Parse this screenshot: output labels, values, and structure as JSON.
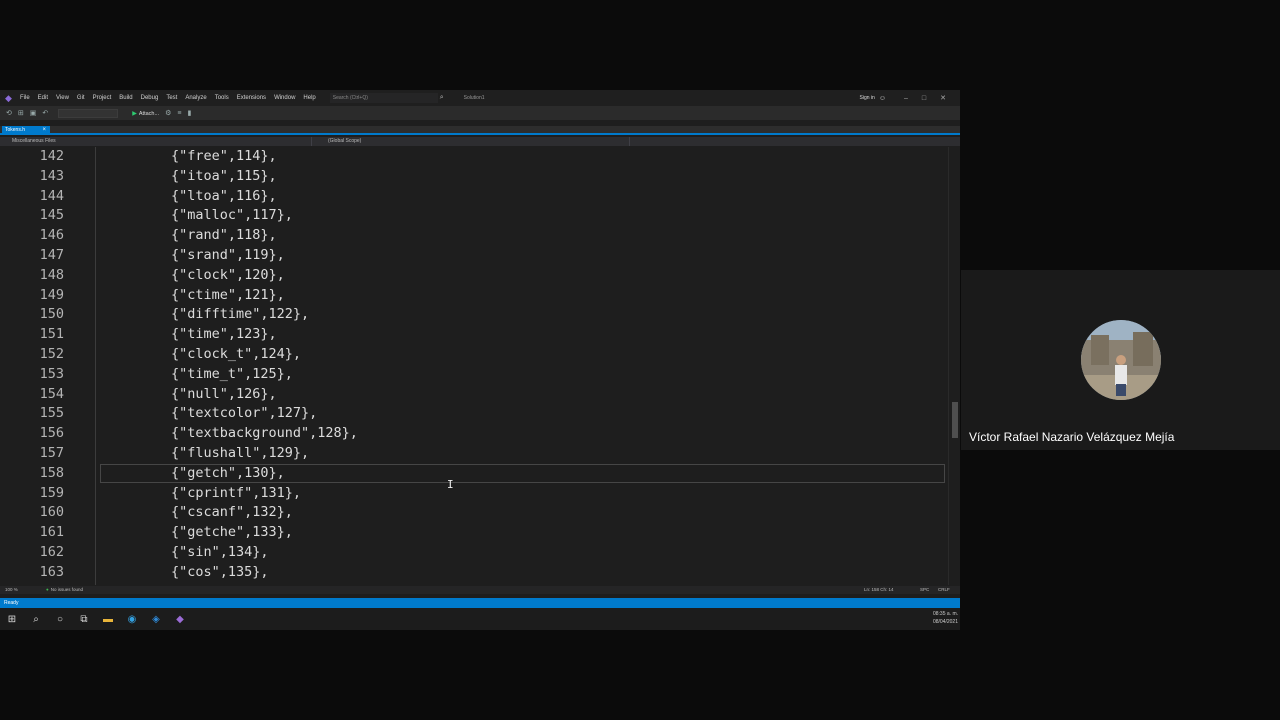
{
  "menubar": {
    "items": [
      "File",
      "Edit",
      "View",
      "Git",
      "Project",
      "Build",
      "Debug",
      "Test",
      "Analyze",
      "Tools",
      "Extensions",
      "Window",
      "Help"
    ],
    "search_placeholder": "Search (Ctrl+Q)",
    "solution": "Solution1",
    "sign_in": "Sign in"
  },
  "toolbar": {
    "attach_label": "Attach..."
  },
  "tabs": {
    "active": "Tokens.h"
  },
  "navbar": {
    "project": "Miscellaneous Files",
    "scope": "(Global Scope)"
  },
  "editor": {
    "current_line": 158,
    "lines": [
      {
        "n": "142",
        "code": "{\"free\",114},"
      },
      {
        "n": "143",
        "code": "{\"itoa\",115},"
      },
      {
        "n": "144",
        "code": "{\"ltoa\",116},"
      },
      {
        "n": "145",
        "code": "{\"malloc\",117},"
      },
      {
        "n": "146",
        "code": "{\"rand\",118},"
      },
      {
        "n": "147",
        "code": "{\"srand\",119},"
      },
      {
        "n": "148",
        "code": "{\"clock\",120},"
      },
      {
        "n": "149",
        "code": "{\"ctime\",121},"
      },
      {
        "n": "150",
        "code": "{\"difftime\",122},"
      },
      {
        "n": "151",
        "code": "{\"time\",123},"
      },
      {
        "n": "152",
        "code": "{\"clock_t\",124},"
      },
      {
        "n": "153",
        "code": "{\"time_t\",125},"
      },
      {
        "n": "154",
        "code": "{\"null\",126},"
      },
      {
        "n": "155",
        "code": "{\"textcolor\",127},"
      },
      {
        "n": "156",
        "code": "{\"textbackground\",128},"
      },
      {
        "n": "157",
        "code": "{\"flushall\",129},"
      },
      {
        "n": "158",
        "code": "{\"getch\",130},"
      },
      {
        "n": "159",
        "code": "{\"cprintf\",131},"
      },
      {
        "n": "160",
        "code": "{\"cscanf\",132},"
      },
      {
        "n": "161",
        "code": "{\"getche\",133},"
      },
      {
        "n": "162",
        "code": "{\"sin\",134},"
      },
      {
        "n": "163",
        "code": "{\"cos\",135},"
      }
    ]
  },
  "editor_status": {
    "zoom": "100 %",
    "issues": "No issues found",
    "position": "Ln: 158   Ch: 14",
    "encoding": "SPC",
    "line_ending": "CRLF"
  },
  "statusbar": {
    "text": "Ready"
  },
  "taskbar": {
    "time": "08:35 a. m.",
    "date": "08/04/2021"
  },
  "participant": {
    "name": "Víctor Rafael Nazario Velázquez Mejía"
  },
  "colors": {
    "accent": "#007acc",
    "editor_bg": "#1e1e1e"
  }
}
